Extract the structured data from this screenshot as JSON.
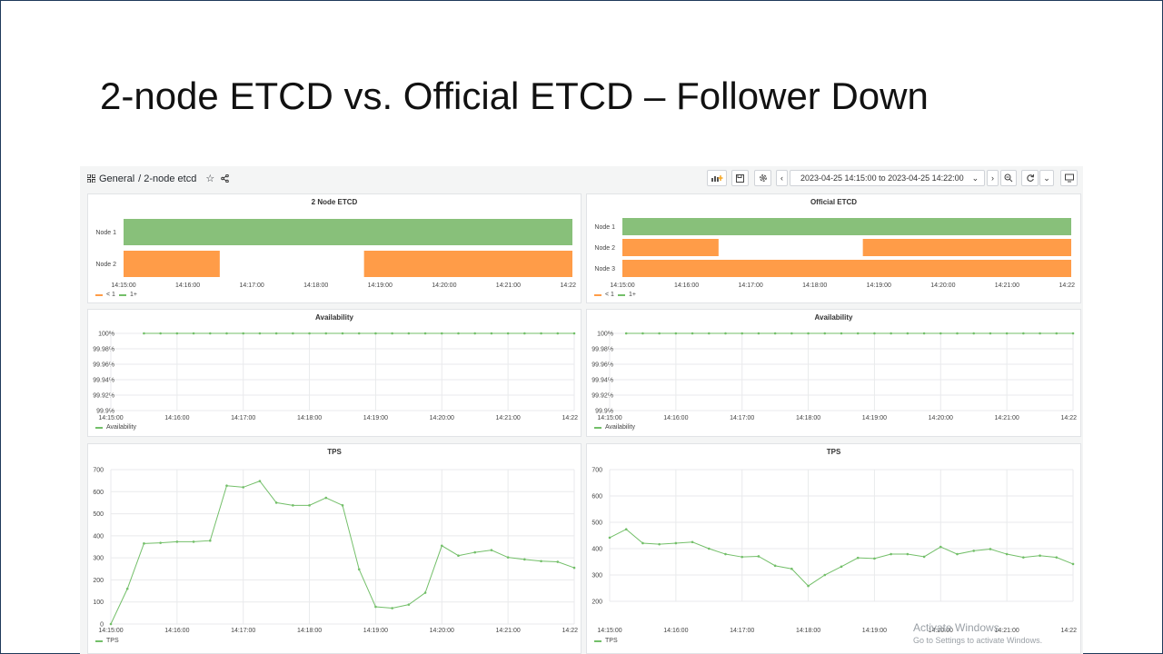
{
  "slide": {
    "title": "2-node ETCD vs. Official ETCD – Follower Down"
  },
  "dashboard": {
    "breadcrumb_root": "General",
    "breadcrumb_name": "/ 2-node etcd",
    "time_range": "2023-04-25 14:15:00 to 2023-04-25 14:22:00",
    "icons": [
      "dashboard-grid-icon",
      "star-icon",
      "share-icon",
      "add-panel-icon",
      "save-icon",
      "settings-icon",
      "chevron-left-icon",
      "clock-icon",
      "chevron-down-icon",
      "chevron-right-icon",
      "zoom-out-icon",
      "refresh-icon",
      "chevron-down-icon",
      "tv-mode-icon"
    ]
  },
  "colors": {
    "green": "#73bf69",
    "green_fill": "#88c07a",
    "orange": "#ff9c48",
    "grid": "#e9eaec",
    "axis_text": "#444444"
  },
  "x_ticks": [
    "14:15:00",
    "14:16:00",
    "14:17:00",
    "14:18:00",
    "14:19:00",
    "14:20:00",
    "14:21:00",
    "14:22"
  ],
  "state_legend": {
    "lt1": "< 1",
    "ge1": "1+"
  },
  "panels": {
    "left_state": {
      "title": "2 Node ETCD",
      "rows": [
        {
          "label": "Node 1",
          "segments": [
            {
              "from": "14:15:00",
              "to": "14:22:00",
              "state": "1+"
            }
          ]
        },
        {
          "label": "Node 2",
          "segments": [
            {
              "from": "14:15:00",
              "to": "14:16:30",
              "state": "< 1"
            },
            {
              "from": "14:18:45",
              "to": "14:22:00",
              "state": "< 1"
            }
          ]
        }
      ]
    },
    "right_state": {
      "title": "Official ETCD",
      "rows": [
        {
          "label": "Node 1",
          "segments": [
            {
              "from": "14:15:00",
              "to": "14:22:00",
              "state": "1+"
            }
          ]
        },
        {
          "label": "Node 2",
          "segments": [
            {
              "from": "14:15:00",
              "to": "14:16:30",
              "state": "< 1"
            },
            {
              "from": "14:18:45",
              "to": "14:22:00",
              "state": "< 1"
            }
          ]
        },
        {
          "label": "Node 3",
          "segments": [
            {
              "from": "14:15:00",
              "to": "14:22:00",
              "state": "< 1"
            }
          ]
        }
      ]
    },
    "left_avail": {
      "title": "Availability",
      "legend": "Availability"
    },
    "right_avail": {
      "title": "Availability",
      "legend": "Availability"
    },
    "left_tps": {
      "title": "TPS",
      "legend": "TPS"
    },
    "right_tps": {
      "title": "TPS",
      "legend": "TPS"
    }
  },
  "chart_data": [
    {
      "type": "line",
      "title": "Availability",
      "legend": "Availability",
      "y_ticks": [
        "100%",
        "99.98%",
        "99.96%",
        "99.94%",
        "99.92%",
        "99.9%"
      ],
      "ylim": [
        99.9,
        100
      ],
      "x_start_min": 0.5,
      "x_step_min": 0.25,
      "values": [
        100,
        100,
        100,
        100,
        100,
        100,
        100,
        100,
        100,
        100,
        100,
        100,
        100,
        100,
        100,
        100,
        100,
        100,
        100,
        100,
        100,
        100,
        100,
        100,
        100,
        100,
        100
      ]
    },
    {
      "type": "line",
      "title": "Availability",
      "legend": "Availability",
      "y_ticks": [
        "100%",
        "99.98%",
        "99.96%",
        "99.94%",
        "99.92%",
        "99.9%"
      ],
      "ylim": [
        99.9,
        100
      ],
      "x_start_min": 0.25,
      "x_step_min": 0.25,
      "values": [
        100,
        100,
        100,
        100,
        100,
        100,
        100,
        100,
        100,
        100,
        100,
        100,
        100,
        100,
        100,
        100,
        100,
        100,
        100,
        100,
        100,
        100,
        100,
        100,
        100,
        100,
        100,
        100
      ]
    },
    {
      "type": "line",
      "title": "TPS",
      "legend": "TPS",
      "ylim": [
        0,
        700
      ],
      "y_ticks": [
        "700",
        "600",
        "500",
        "400",
        "300",
        "200",
        "100",
        "0"
      ],
      "x_start_min": 0,
      "x_step_min": 0.25,
      "values": [
        0,
        160,
        365,
        368,
        373,
        373,
        378,
        627,
        620,
        648,
        550,
        538,
        538,
        572,
        538,
        248,
        78,
        72,
        88,
        142,
        355,
        310,
        325,
        335,
        302,
        293,
        285,
        282,
        255
      ]
    },
    {
      "type": "line",
      "title": "TPS",
      "legend": "TPS",
      "ylim": [
        100,
        700
      ],
      "y_ticks": [
        "700",
        "600",
        "500",
        "400",
        "300",
        "200"
      ],
      "x_start_min": 0,
      "x_step_min": 0.25,
      "values": [
        390,
        428,
        365,
        360,
        365,
        370,
        340,
        315,
        302,
        305,
        262,
        248,
        170,
        220,
        258,
        298,
        295,
        315,
        315,
        303,
        348,
        315,
        330,
        338,
        315,
        300,
        308,
        300,
        270
      ]
    }
  ],
  "watermark": {
    "line1": "Activate Windows",
    "line2": "Go to Settings to activate Windows."
  }
}
